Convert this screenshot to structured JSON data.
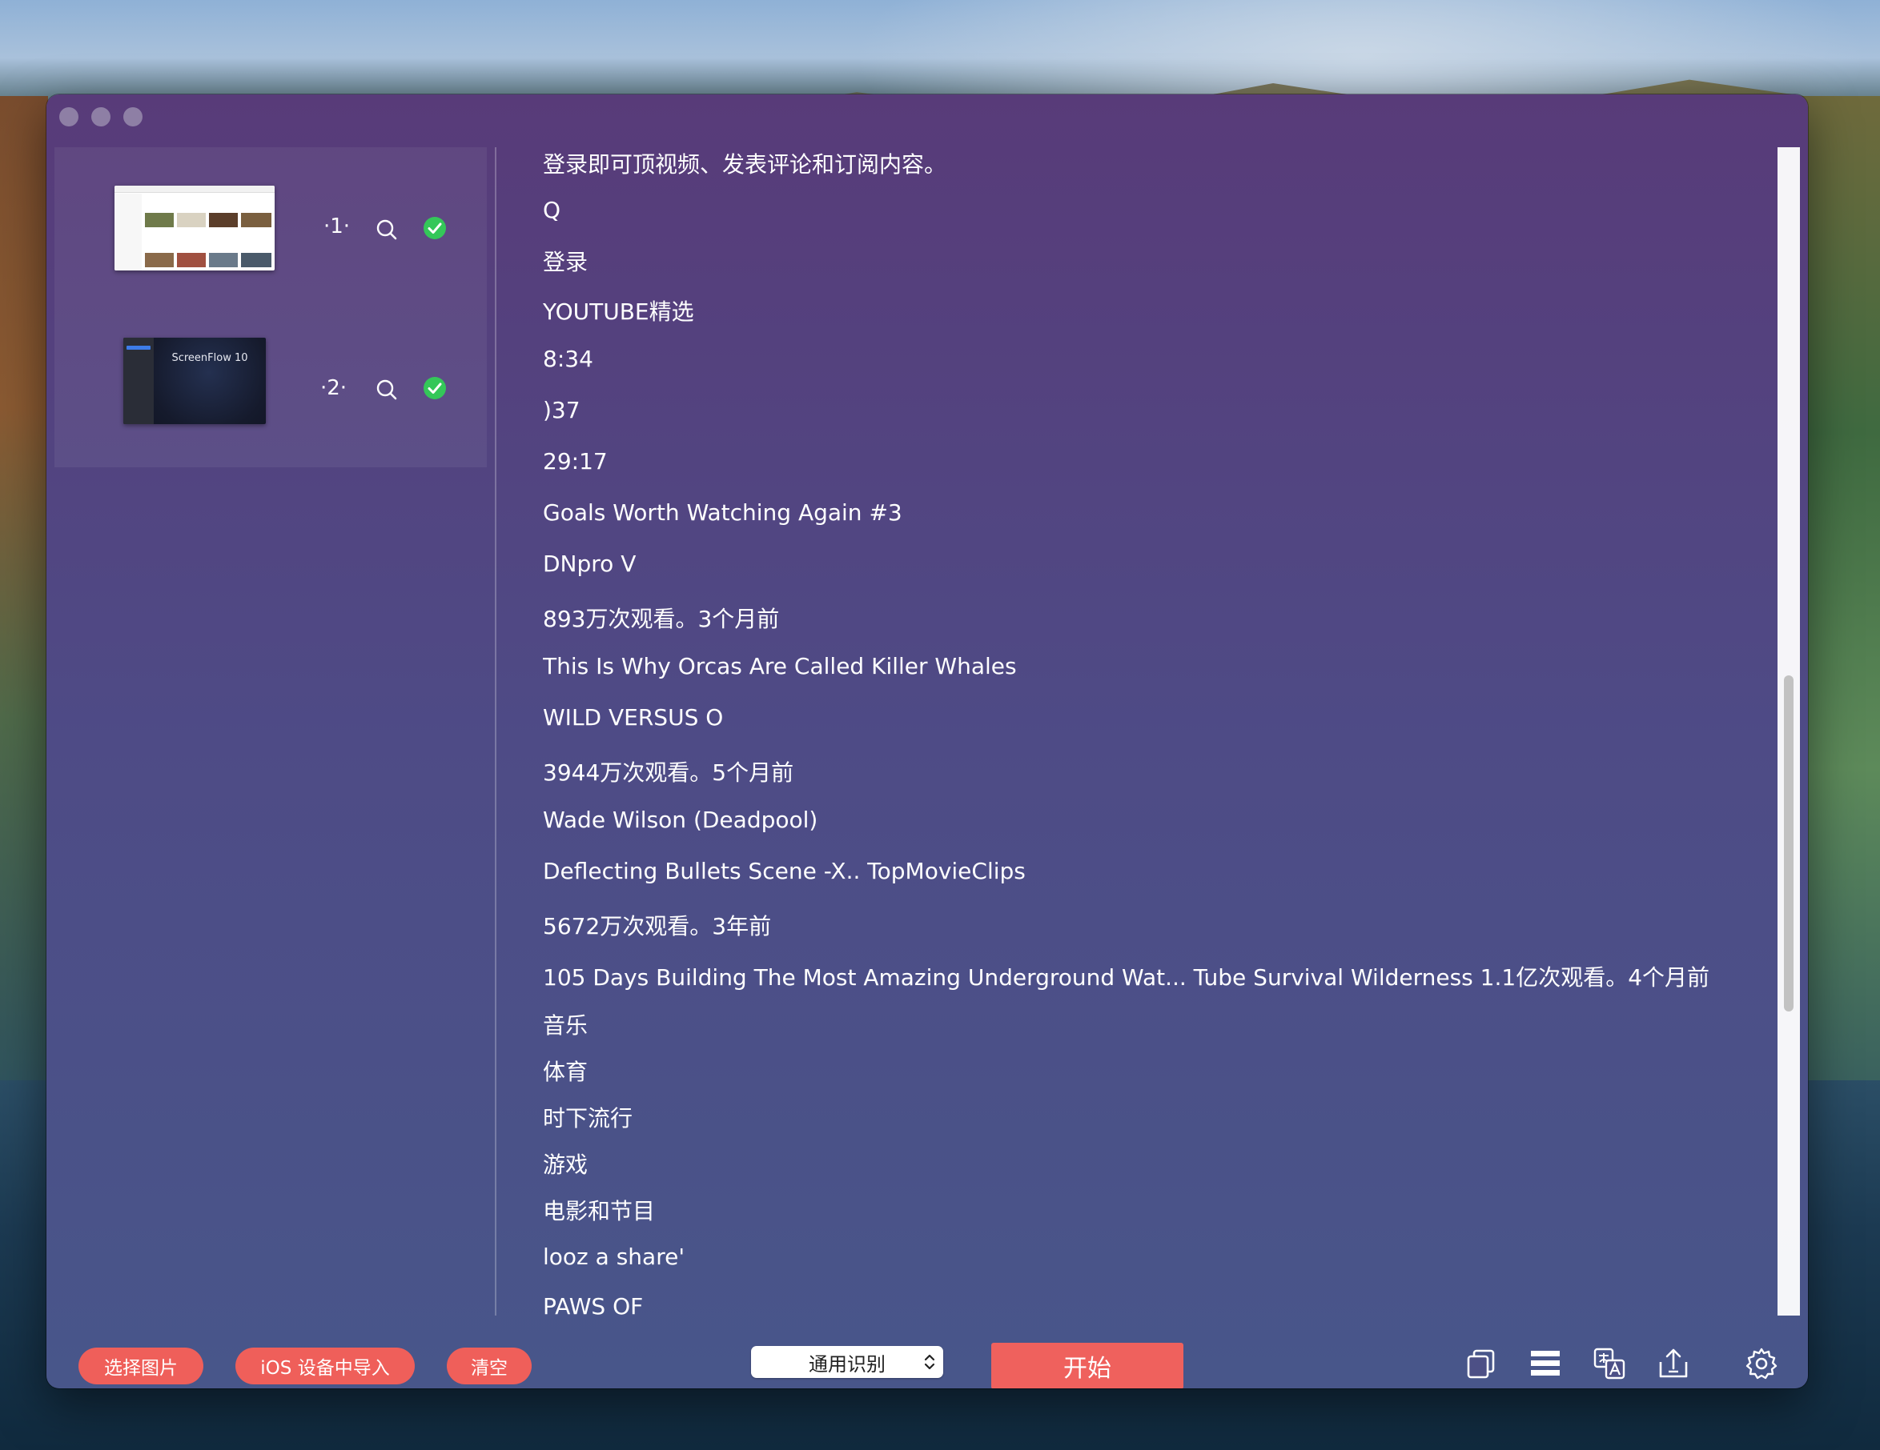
{
  "sidebar": {
    "items": [
      {
        "index_label": "·1·",
        "thumbnail_title": ""
      },
      {
        "index_label": "·2·",
        "thumbnail_title": "ScreenFlow 10"
      }
    ]
  },
  "content": {
    "lines": [
      "登录即可顶视频、发表评论和订阅内容。",
      "Q",
      "登录",
      "YOUTUBE精选",
      "8:34",
      ")37",
      "29:17",
      "Goals Worth Watching Again #3",
      "DNpro V",
      "893万次观看。3个月前",
      "This Is Why Orcas Are Called Killer Whales",
      "WILD VERSUS O",
      "3944万次观看。5个月前",
      "Wade Wilson (Deadpool)",
      "Deflecting Bullets Scene -X.. TopMovieClips",
      "5672万次观看。3年前",
      "105 Days Building The Most Amazing Underground Wat... Tube Survival Wilderness 1.1亿次观看。4个月前",
      "音乐",
      "体育",
      "时下流行",
      "游戏",
      "电影和节目",
      "looz a share'",
      "PAWS OF"
    ]
  },
  "footer": {
    "select_image_label": "选择图片",
    "ios_import_label": "iOS 设备中导入",
    "clear_label": "清空",
    "mode_select_value": "通用识别",
    "start_label": "开始"
  },
  "icons": {
    "search": "search-icon",
    "check": "check-circle-icon",
    "copy": "copy-icon",
    "list": "list-icon",
    "translate": "translate-icon",
    "export": "export-icon",
    "settings": "gear-icon"
  },
  "colors": {
    "accent": "#ef5f5a",
    "check": "#34c759",
    "window_top": "#583b79",
    "window_bottom": "#48568a"
  }
}
